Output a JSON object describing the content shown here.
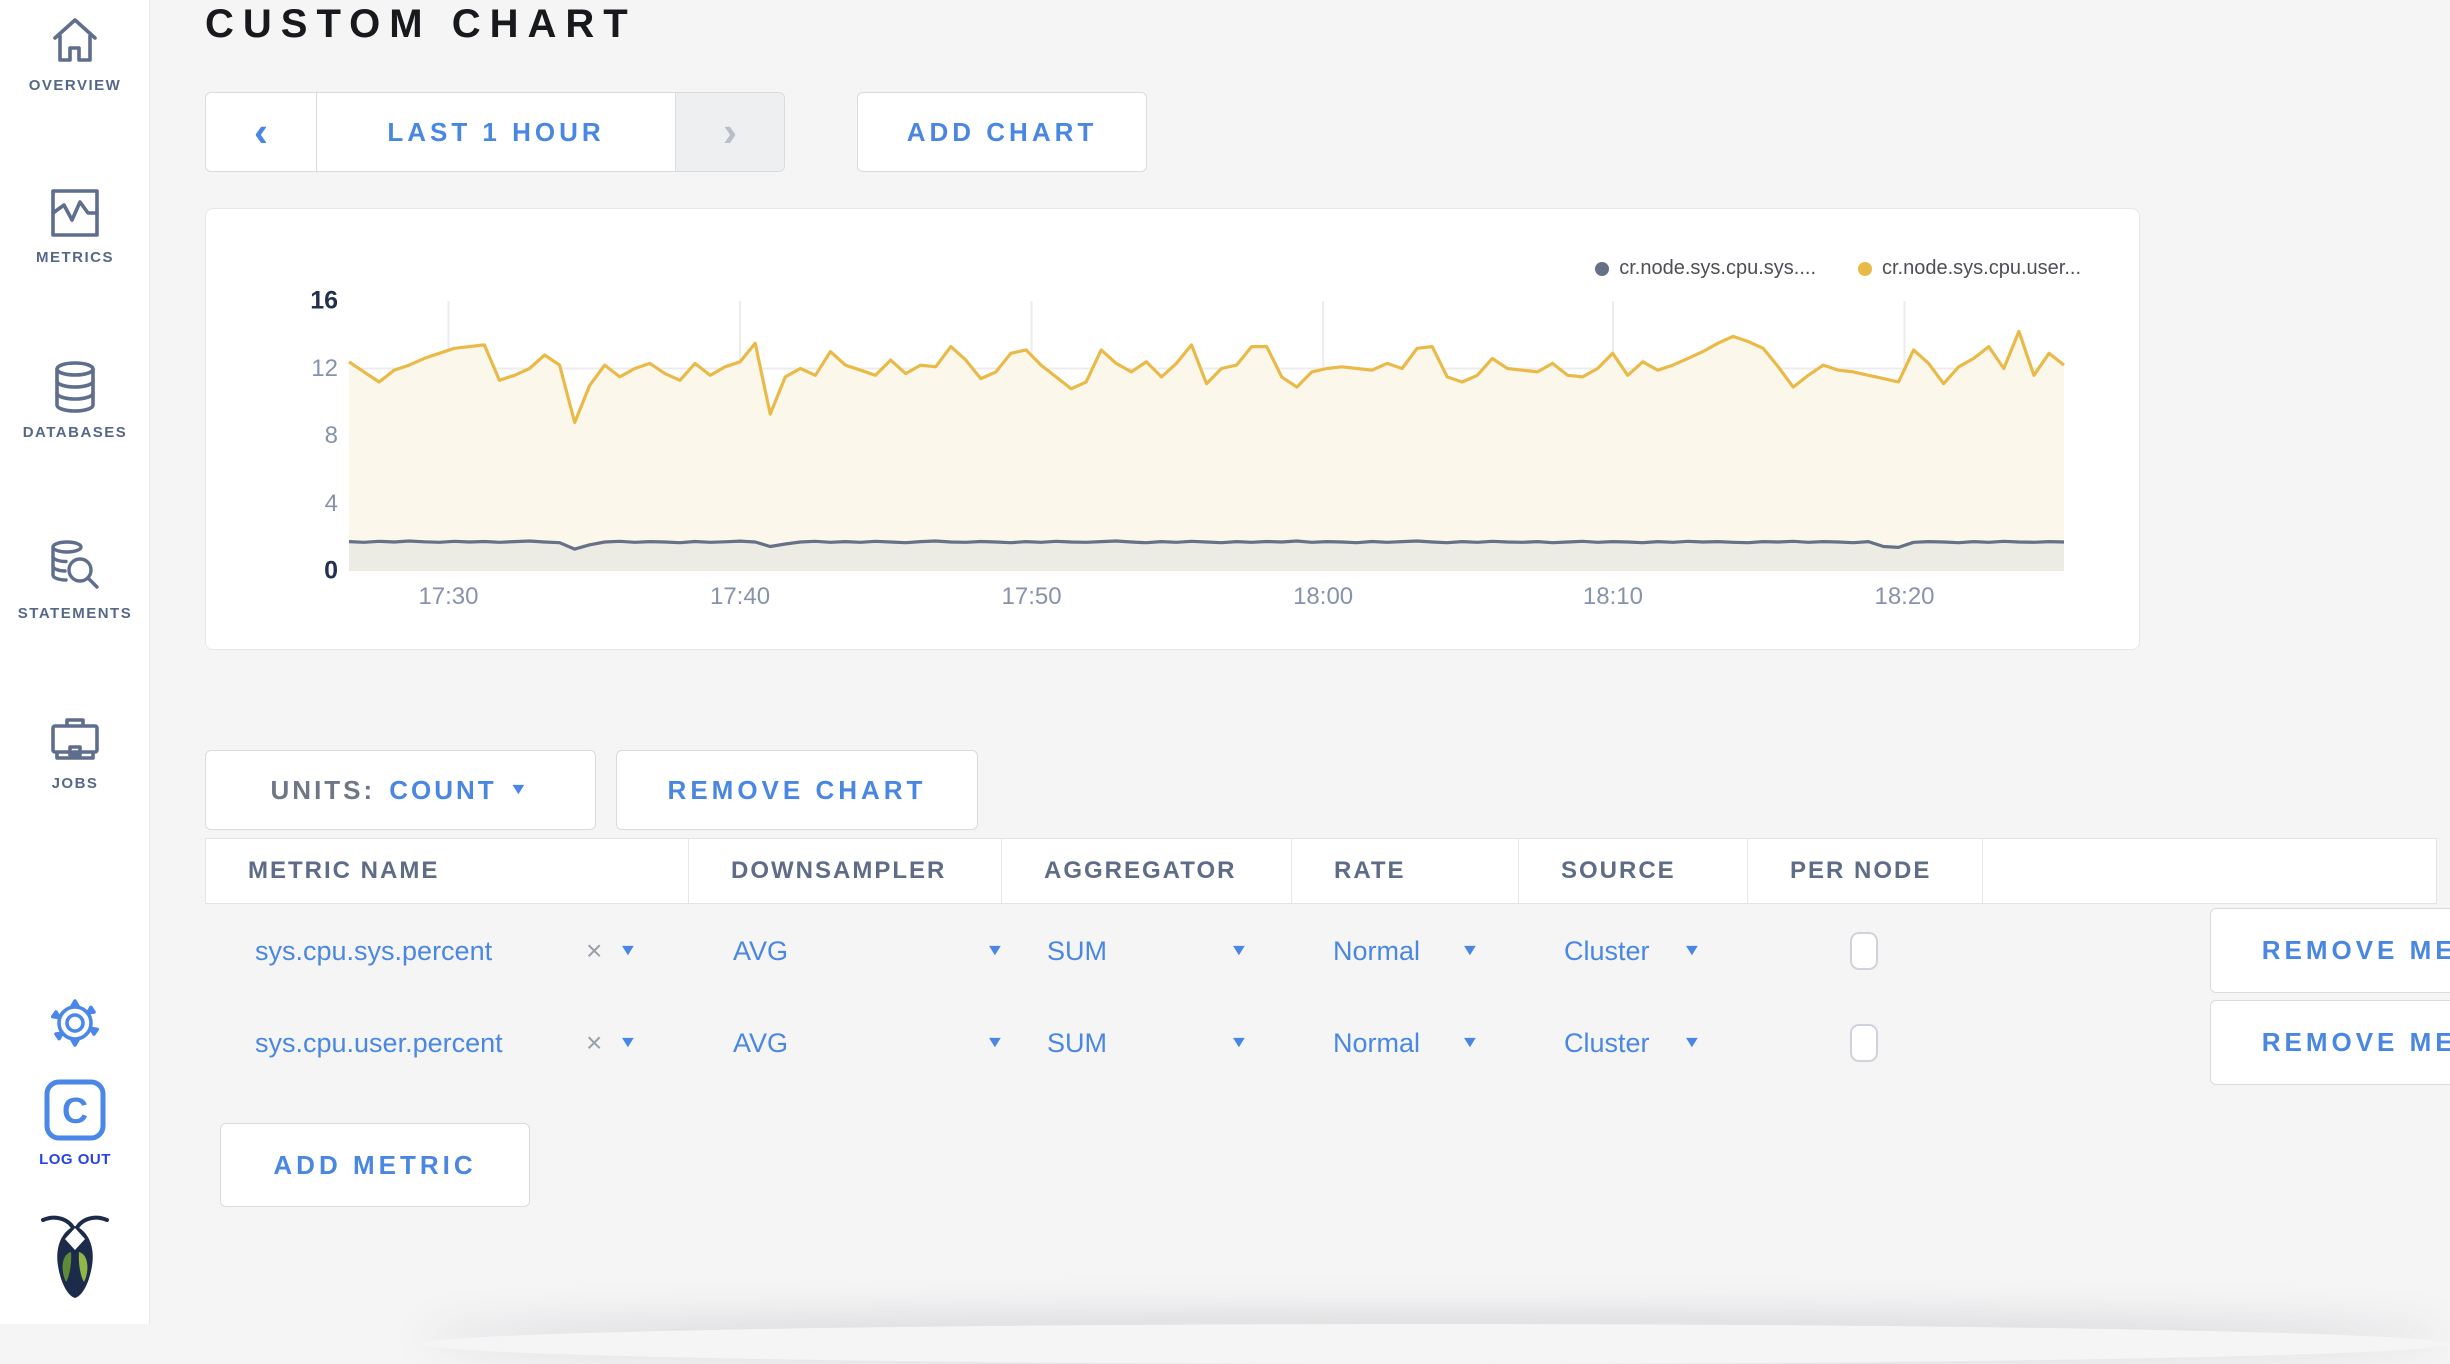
{
  "sidebar": {
    "items": [
      {
        "label": "OVERVIEW",
        "icon": "home-icon"
      },
      {
        "label": "METRICS",
        "icon": "metrics-icon"
      },
      {
        "label": "DATABASES",
        "icon": "databases-icon"
      },
      {
        "label": "STATEMENTS",
        "icon": "statements-icon"
      },
      {
        "label": "JOBS",
        "icon": "jobs-icon"
      }
    ],
    "logout_label": "LOG OUT"
  },
  "header": {
    "title": "CUSTOM CHART"
  },
  "toolbar": {
    "prev_glyph": "‹",
    "time_range": "LAST 1 HOUR",
    "next_glyph": "›",
    "add_chart": "ADD CHART"
  },
  "chart_controls": {
    "units_label": "UNITS:",
    "units_value": "COUNT",
    "remove_chart": "REMOVE CHART"
  },
  "chart_data": {
    "type": "area",
    "x_ticks": [
      "17:30",
      "17:40",
      "17:50",
      "18:00",
      "18:10",
      "18:20"
    ],
    "x_tick_fractions": [
      0.058,
      0.228,
      0.398,
      0.568,
      0.737,
      0.907
    ],
    "y_ticks": [
      0,
      4,
      8,
      12,
      16
    ],
    "ylim": [
      0,
      16
    ],
    "grid": true,
    "legend_position": "top-right",
    "series": [
      {
        "name": "cr.node.sys.cpu.sys....",
        "color": "#667087",
        "fill": "#ecebe4",
        "values": [
          1.74,
          1.7,
          1.76,
          1.72,
          1.78,
          1.73,
          1.7,
          1.76,
          1.72,
          1.75,
          1.7,
          1.74,
          1.78,
          1.72,
          1.68,
          1.3,
          1.55,
          1.72,
          1.76,
          1.7,
          1.74,
          1.72,
          1.68,
          1.75,
          1.7,
          1.73,
          1.77,
          1.72,
          1.45,
          1.6,
          1.72,
          1.76,
          1.7,
          1.74,
          1.7,
          1.76,
          1.72,
          1.68,
          1.74,
          1.78,
          1.72,
          1.7,
          1.75,
          1.72,
          1.68,
          1.74,
          1.7,
          1.76,
          1.72,
          1.7,
          1.74,
          1.78,
          1.72,
          1.68,
          1.74,
          1.7,
          1.76,
          1.72,
          1.68,
          1.74,
          1.7,
          1.75,
          1.72,
          1.78,
          1.7,
          1.74,
          1.72,
          1.68,
          1.75,
          1.7,
          1.74,
          1.78,
          1.72,
          1.68,
          1.74,
          1.7,
          1.76,
          1.72,
          1.7,
          1.74,
          1.68,
          1.72,
          1.76,
          1.7,
          1.74,
          1.72,
          1.68,
          1.74,
          1.7,
          1.76,
          1.72,
          1.74,
          1.7,
          1.68,
          1.74,
          1.72,
          1.76,
          1.7,
          1.74,
          1.72,
          1.68,
          1.74,
          1.45,
          1.4,
          1.7,
          1.74,
          1.72,
          1.68,
          1.74,
          1.7,
          1.76,
          1.72,
          1.7,
          1.74,
          1.72
        ]
      },
      {
        "name": "cr.node.sys.cpu.user...",
        "color": "#eaba48",
        "fill": "#fbf7ea",
        "values": [
          12.4,
          11.8,
          11.2,
          11.9,
          12.2,
          12.6,
          12.9,
          13.2,
          13.3,
          13.4,
          11.3,
          11.6,
          12.0,
          12.8,
          12.2,
          8.8,
          11.0,
          12.2,
          11.5,
          12.0,
          12.3,
          11.7,
          11.3,
          12.3,
          11.6,
          12.1,
          12.4,
          13.5,
          9.3,
          11.5,
          12.0,
          11.6,
          13.0,
          12.2,
          11.9,
          11.6,
          12.5,
          11.7,
          12.2,
          12.1,
          13.3,
          12.5,
          11.4,
          11.8,
          12.9,
          13.1,
          12.2,
          11.5,
          10.8,
          11.2,
          13.1,
          12.3,
          11.8,
          12.4,
          11.5,
          12.3,
          13.4,
          11.1,
          12.0,
          12.2,
          13.3,
          13.3,
          11.5,
          10.9,
          11.8,
          12.0,
          12.1,
          12.0,
          11.9,
          12.3,
          12.0,
          13.2,
          13.3,
          11.5,
          11.2,
          11.6,
          12.6,
          12.0,
          11.9,
          11.8,
          12.3,
          11.6,
          11.5,
          12.0,
          12.9,
          11.6,
          12.4,
          11.9,
          12.2,
          12.6,
          13.0,
          13.5,
          13.9,
          13.6,
          13.2,
          12.1,
          10.9,
          11.6,
          12.2,
          11.9,
          11.8,
          11.6,
          11.4,
          11.2,
          13.1,
          12.3,
          11.1,
          12.1,
          12.6,
          13.3,
          12.0,
          14.2,
          11.6,
          12.9,
          12.2
        ]
      }
    ]
  },
  "metrics_table": {
    "columns": [
      "METRIC NAME",
      "DOWNSAMPLER",
      "AGGREGATOR",
      "RATE",
      "SOURCE",
      "PER NODE"
    ],
    "clear_glyph": "×",
    "caret_glyph": "▼",
    "rows": [
      {
        "metric": "sys.cpu.sys.percent",
        "downsampler": "AVG",
        "aggregator": "SUM",
        "rate": "Normal",
        "source": "Cluster",
        "per_node_checked": false,
        "remove_label": "REMOVE METRIC"
      },
      {
        "metric": "sys.cpu.user.percent",
        "downsampler": "AVG",
        "aggregator": "SUM",
        "rate": "Normal",
        "source": "Cluster",
        "per_node_checked": false,
        "remove_label": "REMOVE METRIC"
      }
    ],
    "add_metric": "ADD METRIC"
  },
  "colors": {
    "accent_blue": "#4a87e2",
    "logout_blue": "#2743e3",
    "slate": "#5f6e8d",
    "series_user_yellow": "#eaba48",
    "series_sys_gray": "#667087",
    "page_bg": "#f5f5f6"
  }
}
